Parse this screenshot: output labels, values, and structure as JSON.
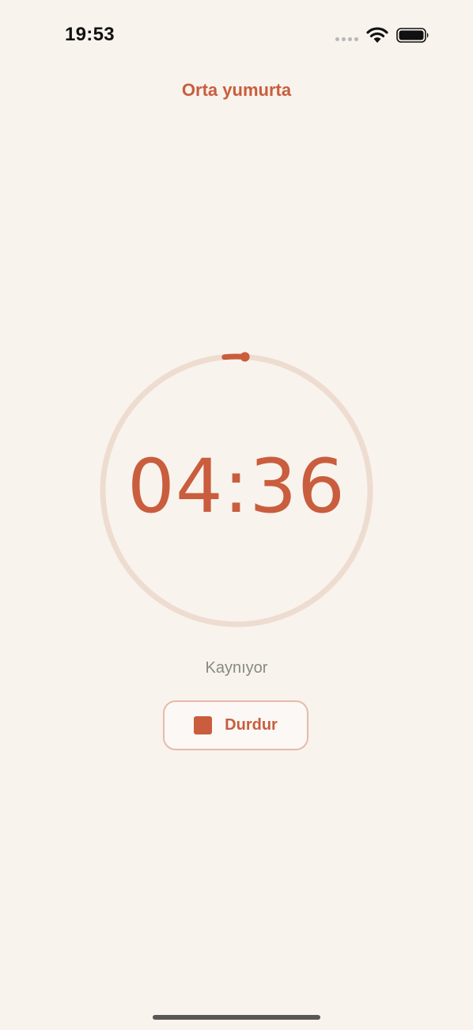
{
  "status_bar": {
    "time": "19:53"
  },
  "header": {
    "title": "Orta yumurta"
  },
  "timer": {
    "display": "04:36",
    "status": "Kaynıyor",
    "progress": 0.01
  },
  "controls": {
    "stop_label": "Durdur"
  },
  "colors": {
    "accent": "#c95d3d",
    "background": "#f8f3ed",
    "ring_track": "#eedcd1",
    "button_border": "#e6bba8",
    "muted_text": "#888a7d"
  },
  "icons": {
    "signal": "signal-dots-icon",
    "wifi": "wifi-icon",
    "battery": "battery-icon",
    "stop": "stop-square-icon"
  }
}
